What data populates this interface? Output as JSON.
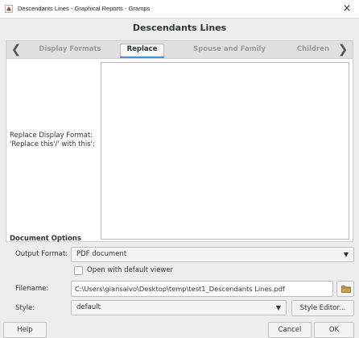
{
  "window": {
    "title": "Descendants Lines - Graphical Reports - Gramps",
    "close_glyph": "×",
    "icon": "gramps-app-icon"
  },
  "dialog": {
    "heading": "Descendants Lines",
    "tabs": [
      {
        "label": "Display Formats",
        "active": false
      },
      {
        "label": "Replace",
        "active": true
      },
      {
        "label": "Spouse and Family",
        "active": false
      },
      {
        "label": "Children",
        "active": false
      }
    ],
    "tab_prev_glyph": "❮",
    "tab_next_glyph": "❯",
    "replace": {
      "label": "Replace Display Format:\n'Replace this'/' with this':",
      "textarea_value": ""
    }
  },
  "document_options": {
    "section_title": "Document Options",
    "output_format": {
      "label": "Output Format:",
      "value": "PDF document"
    },
    "open_with_viewer": {
      "label": "Open with default viewer",
      "checked": false
    },
    "filename": {
      "label": "Filename:",
      "value": "C:\\Users\\giansalvo\\Desktop\\temp\\test1_Descendants Lines.pdf"
    },
    "style": {
      "label": "Style:",
      "value": "default",
      "editor_button": "Style Editor..."
    }
  },
  "buttons": {
    "help": "Help",
    "cancel": "Cancel",
    "ok": "OK"
  },
  "colors": {
    "accent": "#4a90d9",
    "dialog_bg": "#ededed"
  }
}
